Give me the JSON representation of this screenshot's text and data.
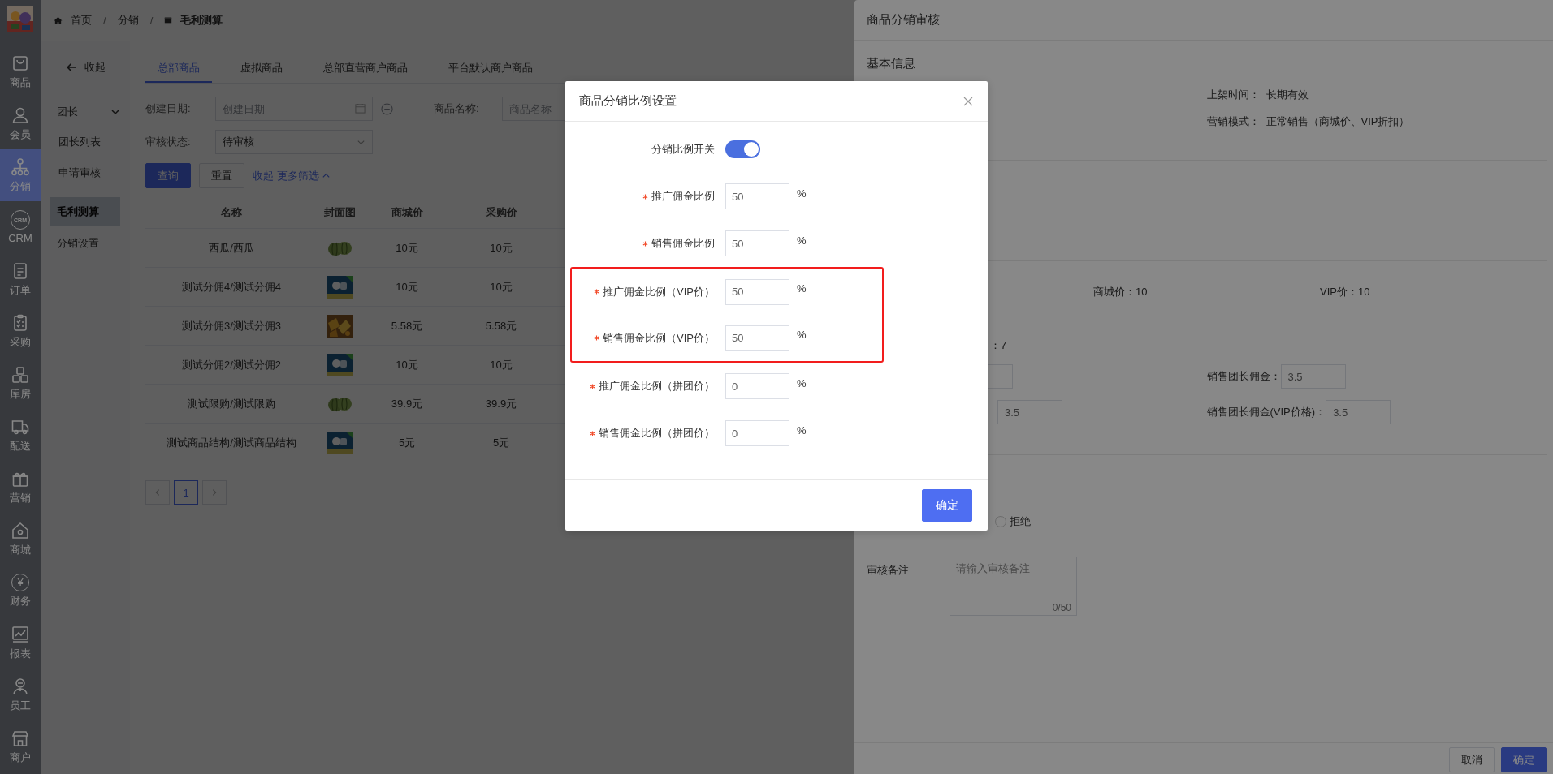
{
  "rail": {
    "items": [
      {
        "label": "商品",
        "selected": false
      },
      {
        "label": "会员",
        "selected": false
      },
      {
        "label": "分销",
        "selected": true
      },
      {
        "label": "CRM",
        "icon_text": "CRM",
        "selected": false
      },
      {
        "label": "订单",
        "selected": false
      },
      {
        "label": "采购",
        "selected": false
      },
      {
        "label": "库房",
        "selected": false
      },
      {
        "label": "配送",
        "selected": false
      },
      {
        "label": "营销",
        "selected": false
      },
      {
        "label": "商城",
        "selected": false
      },
      {
        "label": "财务",
        "icon_text": "¥",
        "selected": false
      },
      {
        "label": "报表",
        "selected": false
      },
      {
        "label": "员工",
        "selected": false
      },
      {
        "label": "商户",
        "selected": false
      }
    ]
  },
  "breadcrumb": [
    {
      "kind": "home",
      "label": "首页"
    },
    {
      "kind": "sep",
      "label": "/"
    },
    {
      "kind": "link",
      "label": "分销"
    },
    {
      "kind": "sep",
      "label": "/"
    },
    {
      "kind": "current",
      "label": "毛利测算"
    }
  ],
  "side_menu": [
    {
      "kind": "back",
      "label": "收起"
    },
    {
      "kind": "group",
      "label": "团长",
      "expanded": true,
      "children": [
        {
          "label": "团长列表",
          "selected": false
        },
        {
          "label": "申请审核",
          "selected": false
        }
      ]
    },
    {
      "kind": "item",
      "label": "毛利测算",
      "selected": true
    },
    {
      "kind": "item",
      "label": "分销设置",
      "selected": false
    }
  ],
  "tabs": [
    {
      "label": "总部商品",
      "selected": true
    },
    {
      "label": "虚拟商品",
      "selected": false
    },
    {
      "label": "总部直营商户商品",
      "selected": false
    },
    {
      "label": "平台默认商户商品",
      "selected": false
    }
  ],
  "filters": {
    "created_date": {
      "label": "创建日期:",
      "placeholder": "创建日期"
    },
    "product_name": {
      "label": "商品名称:",
      "placeholder": "商品名称"
    },
    "review_status": {
      "label": "审核状态:",
      "value": "待审核"
    }
  },
  "actions": {
    "search": "查询",
    "reset": "重置",
    "toggle": "收起 更多筛选"
  },
  "table": {
    "columns": [
      "名称",
      "封面图",
      "商城价",
      "采购价"
    ],
    "rows": [
      {
        "name": "西瓜/西瓜",
        "mall_price": "10元",
        "purchase_price": "10元"
      },
      {
        "name": "测试分佣4/测试分佣4",
        "mall_price": "10元",
        "purchase_price": "10元"
      },
      {
        "name": "测试分佣3/测试分佣3",
        "mall_price": "5.58元",
        "purchase_price": "5.58元"
      },
      {
        "name": "测试分佣2/测试分佣2",
        "mall_price": "10元",
        "purchase_price": "10元"
      },
      {
        "name": "测试限购/测试限购",
        "mall_price": "39.9元",
        "purchase_price": "39.9元"
      },
      {
        "name": "测试商品结构/测试商品结构",
        "mall_price": "5元",
        "purchase_price": "5元"
      }
    ]
  },
  "pagination": {
    "pages": [
      {
        "label": "1",
        "selected": true
      }
    ]
  },
  "review_drawer": {
    "title": "商品分销审核",
    "section": "基本信息",
    "info": [
      {
        "label": "上架时间：",
        "value": "长期有效"
      },
      {
        "label": "营销模式：",
        "value": "正常销售（商城价、VIP折扣）"
      }
    ],
    "prices": [
      {
        "label": "商城价：",
        "value": "10"
      },
      {
        "label": "VIP价：",
        "value": "10"
      }
    ],
    "total": "：7",
    "commission_rows": [
      {
        "left": {
          "kind": "cut-field"
        },
        "label": "销售团长佣金：",
        "value": "3.5"
      },
      {
        "left": {
          "kind": "field",
          "value": "3.5"
        },
        "label": "销售团长佣金(VIP价格)：",
        "value": "3.5"
      }
    ],
    "decision": {
      "label": "拒绝",
      "selected": false
    },
    "remark": {
      "label": "审核备注",
      "placeholder": "请输入审核备注",
      "counter": "0/50"
    },
    "buttons": [
      {
        "label": "取消",
        "kind": "default"
      },
      {
        "label": "确定",
        "kind": "primary"
      }
    ]
  },
  "dialog": {
    "title": "商品分销比例设置",
    "switch": {
      "label": "分销比例开关",
      "on": true
    },
    "fields": [
      {
        "label": "推广佣金比例",
        "value": "50",
        "unit": "%",
        "required": true,
        "highlighted": false
      },
      {
        "label": "销售佣金比例",
        "value": "50",
        "unit": "%",
        "required": true,
        "highlighted": false
      },
      {
        "label": "推广佣金比例（VIP价）",
        "value": "50",
        "unit": "%",
        "required": true,
        "highlighted": true
      },
      {
        "label": "销售佣金比例（VIP价）",
        "value": "50",
        "unit": "%",
        "required": true,
        "highlighted": true
      },
      {
        "label": "推广佣金比例（拼团价）",
        "value": "0",
        "unit": "%",
        "required": true,
        "highlighted": false
      },
      {
        "label": "销售佣金比例（拼团价）",
        "value": "0",
        "unit": "%",
        "required": true,
        "highlighted": false
      }
    ],
    "confirm": "确定"
  }
}
